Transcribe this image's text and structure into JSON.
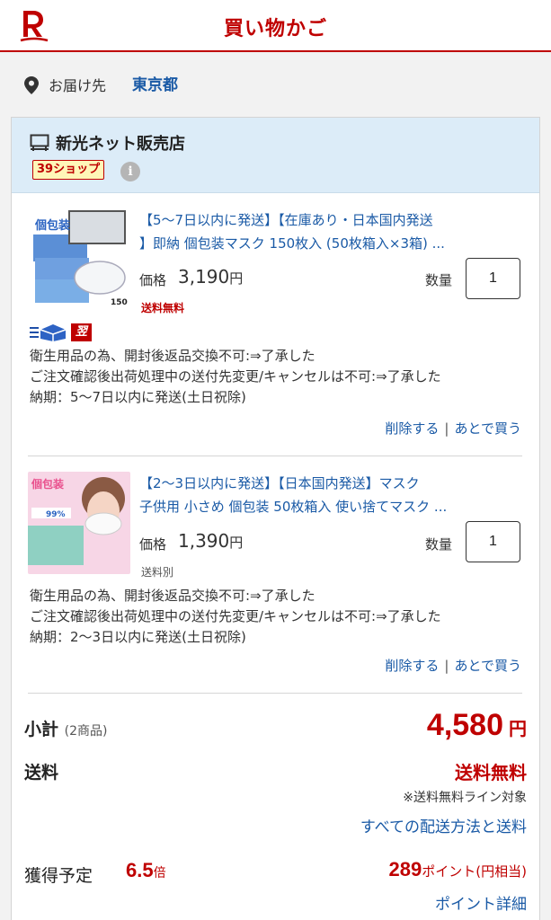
{
  "header": {
    "title": "買い物かご"
  },
  "delivery": {
    "label": "お届け先",
    "value": "東京都"
  },
  "shop": {
    "name": "新光ネット販売店",
    "badge": "39ショップ",
    "info_glyph": "i"
  },
  "items": [
    {
      "title_line1": "【5〜7日以内に発送】【在庫あり・日本国内発送",
      "title_line2": "】即納 個包装マスク 150枚入 (50枚箱入×3箱) ...",
      "price_label": "価格",
      "price": "3,190",
      "price_unit": "円",
      "qty_label": "数量",
      "qty": "1",
      "shipping": "送料無料",
      "next_day_tag": "翌日配達",
      "thumb_text1": "個包装",
      "thumb_text2": "150",
      "notes": [
        "衛生用品の為、開封後返品交換不可:⇒了承した",
        "ご注文確認後出荷処理中の送付先変更/キャンセルは不可:⇒了承した",
        "納期：5〜7日以内に発送(土日祝除)"
      ],
      "delete_label": "削除する",
      "separator": "|",
      "later_label": "あとで買う"
    },
    {
      "title_line1": "【2〜3日以内に発送】【日本国内発送】マスク",
      "title_line2": "子供用 小さめ 個包装 50枚箱入 使い捨てマスク ...",
      "price_label": "価格",
      "price": "1,390",
      "price_unit": "円",
      "qty_label": "数量",
      "qty": "1",
      "shipping": "送料別",
      "thumb_text1": "個包装",
      "thumb_text2": "99%",
      "notes": [
        "衛生用品の為、開封後返品交換不可:⇒了承した",
        "ご注文確認後出荷処理中の送付先変更/キャンセルは不可:⇒了承した",
        "納期：2〜3日以内に発送(土日祝除)"
      ],
      "delete_label": "削除する",
      "separator": "|",
      "later_label": "あとで買う"
    }
  ],
  "summary": {
    "subtotal_label": "小計",
    "subtotal_count": "(2商品)",
    "subtotal_value": "4,580",
    "subtotal_unit": "円",
    "shipping_label": "送料",
    "shipping_value": "送料無料",
    "shipping_note": "※送料無料ライン対象",
    "shipping_link": "すべての配送方法と送料",
    "points_label": "獲得予定",
    "points_rate": "6.5",
    "points_rate_unit": "倍",
    "points_value": "289",
    "points_unit": "ポイント",
    "points_equiv": "(円相当)",
    "points_link": "ポイント詳細"
  },
  "colors": {
    "brand": "#bf0000",
    "link": "#1a5aa6",
    "shop_bg": "#dcecf8"
  },
  "icons": [
    "rakuten-logo",
    "location-pin-icon",
    "shop-icon",
    "info-icon",
    "delivery-truck-icon"
  ]
}
